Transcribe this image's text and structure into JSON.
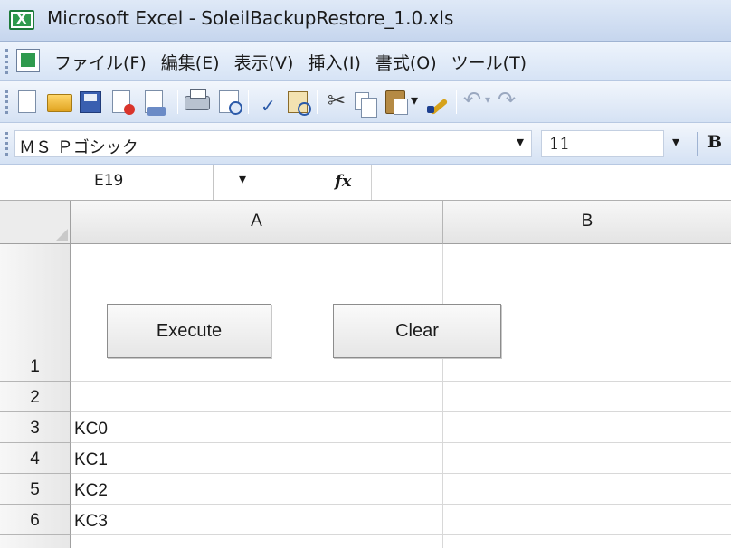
{
  "window": {
    "title": "Microsoft Excel - SoleilBackupRestore_1.0.xls"
  },
  "menu": {
    "items": [
      "ファイル(F)",
      "編集(E)",
      "表示(V)",
      "挿入(I)",
      "書式(O)",
      "ツール(T)"
    ]
  },
  "toolbar": {
    "icons": [
      "new-icon",
      "open-icon",
      "save-icon",
      "permission-icon",
      "email-icon",
      "print-icon",
      "print-preview-icon",
      "spelling-icon",
      "research-icon",
      "cut-icon",
      "copy-icon",
      "paste-icon",
      "format-painter-icon",
      "undo-icon",
      "redo-icon"
    ]
  },
  "format": {
    "font_name": "ＭＳ Ｐゴシック",
    "font_size": "11",
    "bold_label": "B"
  },
  "formula_bar": {
    "name_box": "E19",
    "fx_label": "fx",
    "formula": ""
  },
  "sheet": {
    "columns": [
      "A",
      "B"
    ],
    "rows": [
      {
        "num": "1",
        "a": "",
        "b": ""
      },
      {
        "num": "2",
        "a": "",
        "b": ""
      },
      {
        "num": "3",
        "a": "KC0",
        "b": ""
      },
      {
        "num": "4",
        "a": "KC1",
        "b": ""
      },
      {
        "num": "5",
        "a": "KC2",
        "b": ""
      },
      {
        "num": "6",
        "a": "KC3",
        "b": ""
      }
    ],
    "buttons": {
      "execute": "Execute",
      "clear": "Clear"
    }
  }
}
